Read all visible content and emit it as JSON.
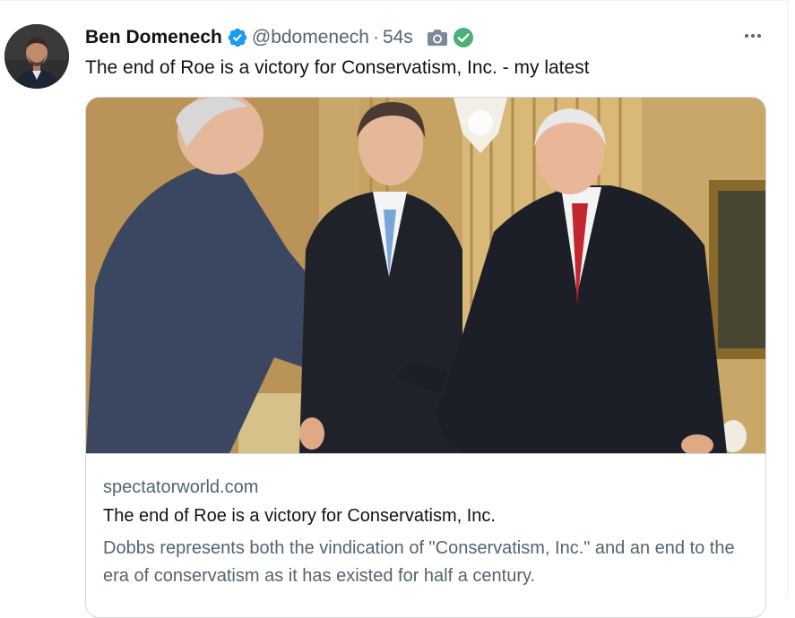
{
  "tweet": {
    "author_name": "Ben Domenech",
    "handle": "@bdomenech",
    "separator": "·",
    "time": "54s",
    "text": "The end of Roe is a victory for Conservatism, Inc. - my latest"
  },
  "link_card": {
    "domain": "spectatorworld.com",
    "title": "The end of Roe is a victory for Conservatism, Inc.",
    "description": "Dobbs represents both the vindication of \"Conservatism, Inc.\" and an end to the era of conservatism as it has existed for half a century."
  },
  "icons": {
    "verified": "verified-badge-icon",
    "camera": "camera-icon",
    "approved": "check-circle-icon",
    "more": "more-options-icon"
  },
  "colors": {
    "verified_blue": "#1d9bf0",
    "check_green": "#4caf76",
    "secondary_text": "#536471"
  }
}
